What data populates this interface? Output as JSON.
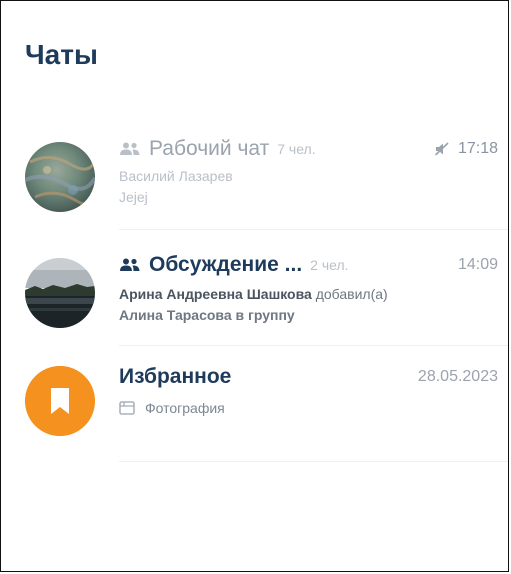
{
  "header": {
    "title": "Чаты"
  },
  "chats": [
    {
      "name": "Рабочий чат",
      "members": "7 чел.",
      "time": "17:18",
      "muted": true,
      "sender": "Василий Лазарев",
      "preview": "Jejej",
      "avatar": "blurred-photo",
      "group_icon": "people-icon",
      "mute_icon": "mute-icon"
    },
    {
      "name": "Обсуждение ...",
      "members": "2 чел.",
      "time": "14:09",
      "message": {
        "actor": "Арина Андреевна Шашкова",
        "action": " добавил(а)",
        "line2": "Алина Тарасова в группу"
      },
      "avatar": "lake-photo",
      "group_icon": "people-icon"
    },
    {
      "name": "Избранное",
      "time": "28.05.2023",
      "preview": "Фотография",
      "avatar": "bookmark-icon",
      "preview_icon": "photo-icon",
      "accent": "#f5911e"
    }
  ]
}
